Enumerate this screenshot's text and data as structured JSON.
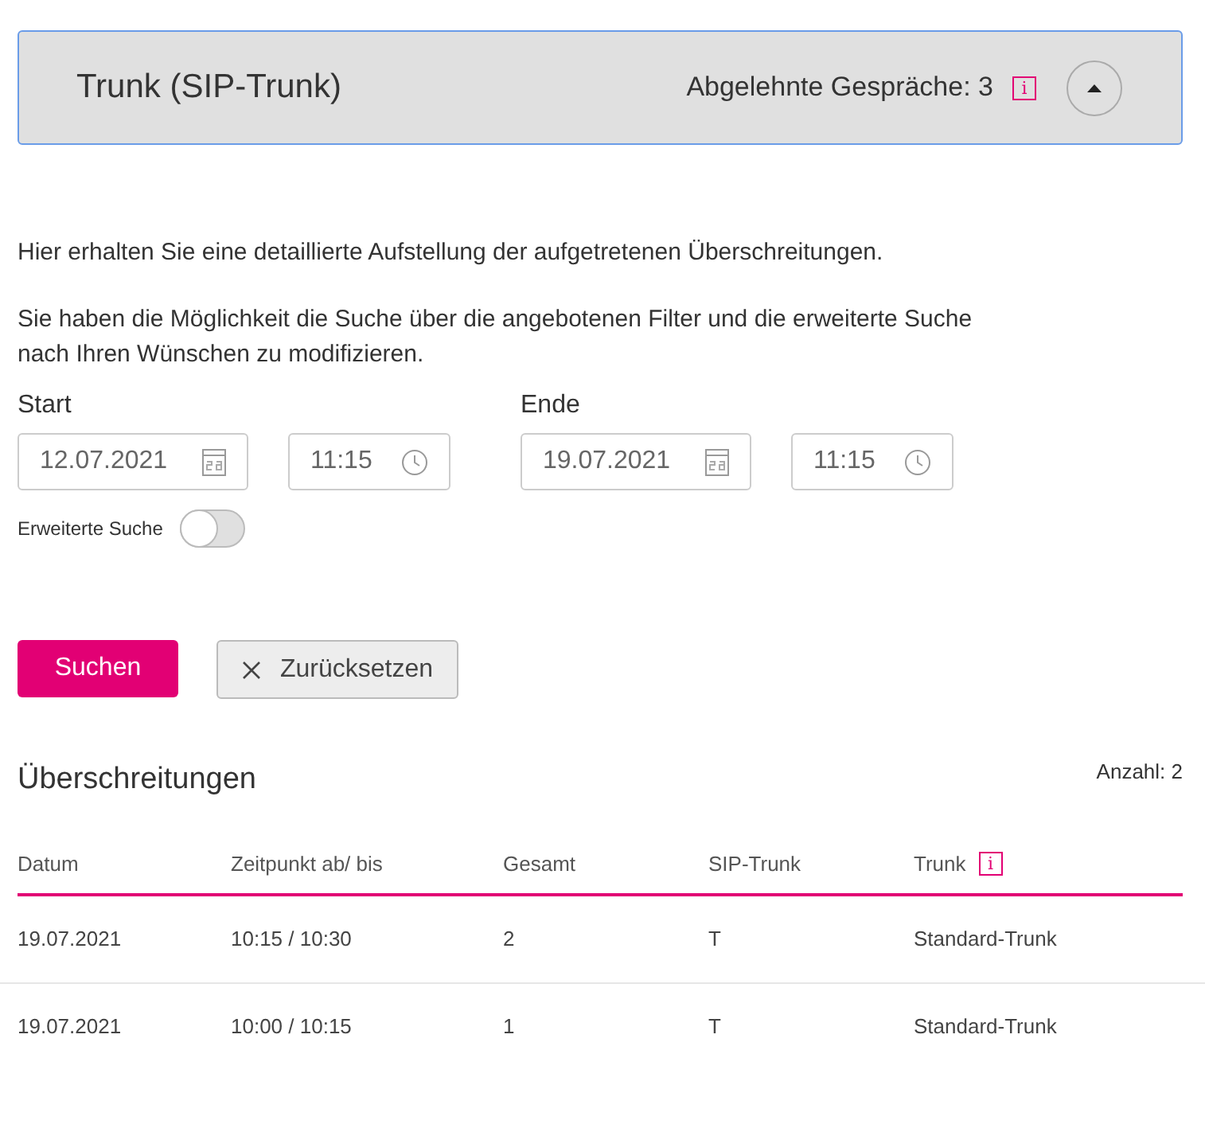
{
  "panel": {
    "title": "Trunk (SIP-Trunk)",
    "summary": "Abgelehnte Gespräche: 3",
    "info": "i",
    "expanded": true
  },
  "intro": [
    "Hier erhalten Sie eine detaillierte Aufstellung der aufgetretenen Überschreitungen.",
    "Sie haben die Möglichkeit die Suche über die angebotenen Filter und die erweiterte Suche nach Ihren Wünschen zu modifizieren."
  ],
  "filters": [
    {
      "label": "Start",
      "date": "12.07.2021",
      "time": "11:15"
    },
    {
      "label": "Ende",
      "date": "19.07.2021",
      "time": "11:15"
    }
  ],
  "advanced_search": {
    "label": "Erweiterte Suche",
    "on": false
  },
  "buttons": {
    "search": "Suchen",
    "reset": "Zurücksetzen"
  },
  "results": {
    "title": "Überschreitungen",
    "count": "Anzahl: 2",
    "info": "i",
    "columns": [
      "Datum",
      "Zeitpunkt ab/ bis",
      "Gesamt",
      "SIP-Trunk",
      "Trunk"
    ],
    "rows": [
      [
        "19.07.2021",
        "10:15 / 10:30",
        "2",
        "T",
        "Standard-Trunk"
      ],
      [
        "19.07.2021",
        "10:00 / 10:15",
        "1",
        "T",
        "Standard-Trunk"
      ]
    ]
  }
}
